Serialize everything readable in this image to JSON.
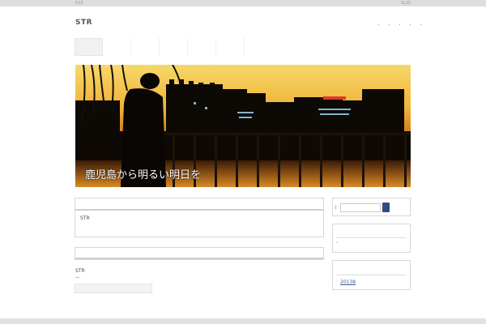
{
  "topbar": {
    "left_text": "RSS",
    "right_text": "SLSS"
  },
  "header": {
    "site_title": "STR",
    "menu_dots": ". . . . ."
  },
  "hero": {
    "caption": "鹿児島から明るい明日を"
  },
  "main": {
    "post1": {
      "excerpt": "STR"
    },
    "post2": {
      "title": "STR",
      "meta": "—"
    }
  },
  "sidebar": {
    "search": {
      "label": "|",
      "placeholder": ""
    },
    "widget2": {
      "item": "-"
    },
    "widget3": {
      "bullet": "◦",
      "link": "20138"
    }
  },
  "colors": {
    "accent": "#2d4f7e",
    "link": "#3b5f94"
  }
}
